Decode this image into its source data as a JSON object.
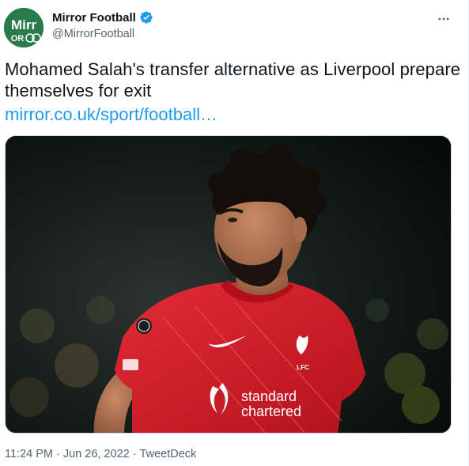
{
  "author": {
    "name": "Mirror Football",
    "handle": "@MirrorFootball",
    "avatar_text": "Mirr",
    "avatar_sub": "OR",
    "verified": true
  },
  "tweet": {
    "text": "Mohamed Salah's transfer alternative as Liverpool prepare themselves for exit",
    "link": "mirror.co.uk/sport/football…"
  },
  "media": {
    "sponsor_line1": "standard",
    "sponsor_line2": "chartered",
    "crest_text": "LFC"
  },
  "meta": {
    "time": "11:24 PM",
    "sep1": "·",
    "date": "Jun 26, 2022",
    "sep2": "·",
    "source": "TweetDeck"
  },
  "colors": {
    "link": "#1d9bf0",
    "secondary": "#536471",
    "verified": "#1d9bf0",
    "avatar_bg": "#2b7a4b",
    "shirt": "#d01a25"
  }
}
